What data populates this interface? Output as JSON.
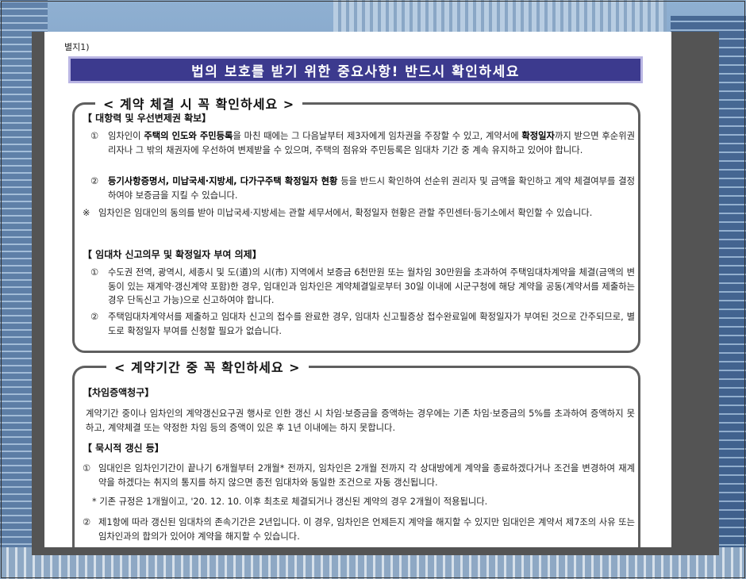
{
  "document": {
    "label": "별지1)",
    "banner": "법의 보호를 받기 위한 중요사항! 반드시 확인하세요"
  },
  "box1": {
    "title": "< 계약 체결 시 꼭 확인하세요 >",
    "section1": {
      "heading": "【 대항력 및 우선변제권 확보】",
      "item1": {
        "num": "①",
        "pre": "임차인이 ",
        "bold1": "주택의 인도와 주민등록",
        "mid": "을 마친 때에는 그 다음날부터 제3자에게 임차권을 주장할 수 있고, 계약서에 ",
        "bold2": "확정일자",
        "post": "까지 받으면 후순위권리자나 그 밖의 채권자에 우선하여 변제받을 수 있으며, 주택의 점유와 주민등록은 임대차 기간 중 계속 유지하고 있어야 합니다."
      },
      "item2": {
        "num": "②",
        "bold": "등기사항증명서, 미납국세·지방세, 다가구주택 확정일자 현황",
        "post": " 등을 반드시 확인하여 선순위 권리자 및 금액을 확인하고 계약 체결여부를 결정하여야 보증금을 지킬 수 있습니다."
      },
      "note": {
        "mark": "※",
        "text": "임차인은 임대인의 동의를 받아 미납국세·지방세는 관할 세무서에서, 확정일자 현황은 관할 주민센터·등기소에서 확인할 수 있습니다."
      }
    },
    "section2": {
      "heading": "【 임대차 신고의무 및 확정일자 부여 의제】",
      "item1": {
        "num": "①",
        "text": "수도권 전역, 광역시, 세종시 및 도(道)의 시(市) 지역에서 보증금 6천만원 또는 월차임 30만원을 초과하여 주택임대차계약을 체결(금액의 변동이 있는 재계약·갱신계약 포함)한 경우, 임대인과 임차인은 계약체결일로부터 30일 이내에 시군구청에 해당 계약을 공동(계약서를 제출하는 경우 단독신고 가능)으로 신고하여야 합니다."
      },
      "item2": {
        "num": "②",
        "text": "주택임대차계약서를 제출하고 임대차 신고의 접수를 완료한 경우, 임대차 신고필증상 접수완료일에 확정일자가 부여된 것으로 간주되므로, 별도로 확정일자 부여를 신청할 필요가 없습니다."
      }
    }
  },
  "box2": {
    "title": "< 계약기간 중 꼭 확인하세요 >",
    "section1": {
      "heading": "【차임증액청구】",
      "text": "계약기간 중이나 임차인의 계약갱신요구권 행사로 인한 갱신 시 차임·보증금을 증액하는 경우에는 기존 차임·보증금의 5%를 초과하여 증액하지 못하고, 계약체결 또는 약정한 차임 등의 증액이 있은 후 1년 이내에는 하지 못합니다."
    },
    "section2": {
      "heading": "【 묵시적 갱신 등】",
      "item1": {
        "num": "①",
        "text": "임대인은 임차인기간이 끝나기 6개월부터 2개월* 전까지, 임차인은 2개월 전까지 각 상대방에게 계약을 종료하겠다거나 조건을 변경하여 재계약을 하겠다는 취지의 통지를 하지 않으면 종전 임대차와 동일한 조건으로 자동 갱신됩니다."
      },
      "footnote": "* 기존 규정은 1개월이고, '20. 12. 10. 이후 최초로 체결되거나 갱신된 계약의 경우 2개월이 적용됩니다.",
      "item2": {
        "num": "②",
        "text": "제1항에 따라 갱신된 임대차의 존속기간은 2년입니다. 이 경우, 임차인은 언제든지 계약을 해지할 수 있지만 임대인은 계약서 제7조의 사유 또는 임차인과의 합의가 있어야 계약을 해지할 수 있습니다."
      }
    }
  }
}
